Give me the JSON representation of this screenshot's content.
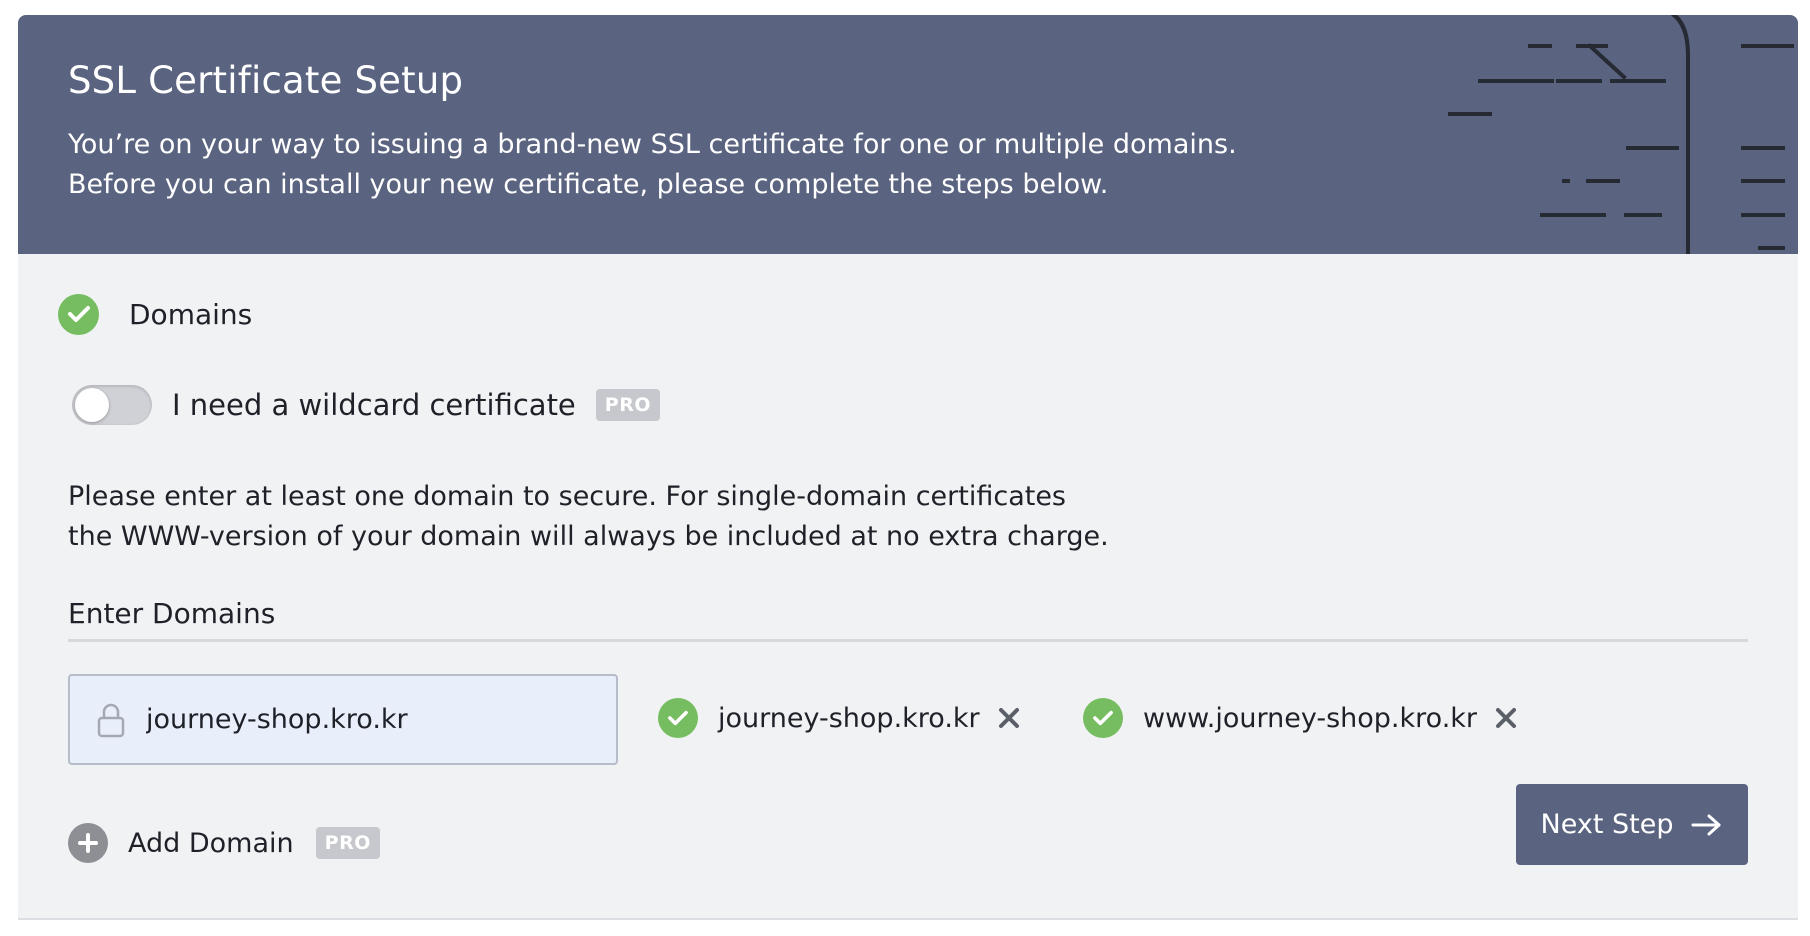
{
  "header": {
    "title": "SSL Certificate Setup",
    "description_line1": "You’re on your way to issuing a brand-new SSL certificate for one or multiple domains.",
    "description_line2": "Before you can install your new certificate, please complete the steps below."
  },
  "step": {
    "label": "Domains",
    "status": "completed"
  },
  "wildcard": {
    "label": "I need a wildcard certificate",
    "badge": "PRO",
    "enabled": false
  },
  "intro": {
    "line1": "Please enter at least one domain to secure. For single-domain certificates",
    "line2": "the WWW-version of your domain will always be included at no extra charge."
  },
  "domains_section": {
    "title": "Enter Domains",
    "input_value": "journey-shop.kro.kr",
    "chips": [
      {
        "label": "journey-shop.kro.kr",
        "status": "valid"
      },
      {
        "label": "www.journey-shop.kro.kr",
        "status": "valid"
      }
    ]
  },
  "add_domain": {
    "label": "Add Domain",
    "badge": "PRO"
  },
  "next_button": {
    "label": "Next Step"
  },
  "colors": {
    "header_bg": "#5a6380",
    "success": "#76bd61",
    "page_bg": "#f1f2f4",
    "badge_bg": "#c6c8cd",
    "input_bg": "#e8eefa"
  },
  "icons": [
    "check-circle-icon",
    "lock-icon",
    "remove-icon",
    "plus-icon",
    "arrow-right-icon"
  ]
}
